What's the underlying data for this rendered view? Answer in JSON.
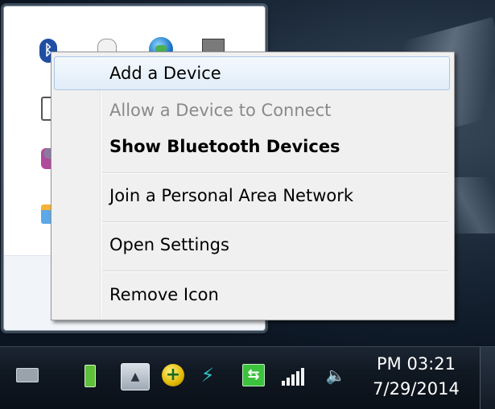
{
  "context_menu": {
    "items": [
      {
        "label": "Add a Device",
        "state": "hover"
      },
      {
        "label": "Allow a Device to Connect",
        "state": "disabled"
      },
      {
        "label": "Show Bluetooth Devices",
        "state": "default-bold"
      },
      {
        "label": "Join a Personal Area Network",
        "state": "normal"
      },
      {
        "label": "Open Settings",
        "state": "normal"
      },
      {
        "label": "Remove Icon",
        "state": "normal"
      }
    ]
  },
  "tray_flyout": {
    "icons": [
      "bluetooth-icon",
      "mouse-icon",
      "network-globe-icon",
      "gray-square-icon",
      "document-icon",
      "people-icon",
      "monitor-icon"
    ]
  },
  "taskbar": {
    "icons": [
      "keyboard-icon",
      "usb-drive-icon",
      "show-hidden-icons-button",
      "add-plus-icon",
      "lightning-icon",
      "sync-icon",
      "signal-bars-icon",
      "volume-icon"
    ],
    "show_hidden_glyph": "▲",
    "plus_glyph": "+",
    "lightning_glyph": "⚡",
    "sync_glyph": "⇆",
    "volume_glyph": "🔈",
    "bluetooth_glyph": "ᛒ",
    "clock": {
      "time": "PM 03:21",
      "date": "7/29/2014"
    }
  },
  "colors": {
    "menu_background": "#f0f0f0",
    "menu_hover": "#e1edf9",
    "disabled_text": "#8a8a8a",
    "taskbar": "#101822"
  }
}
